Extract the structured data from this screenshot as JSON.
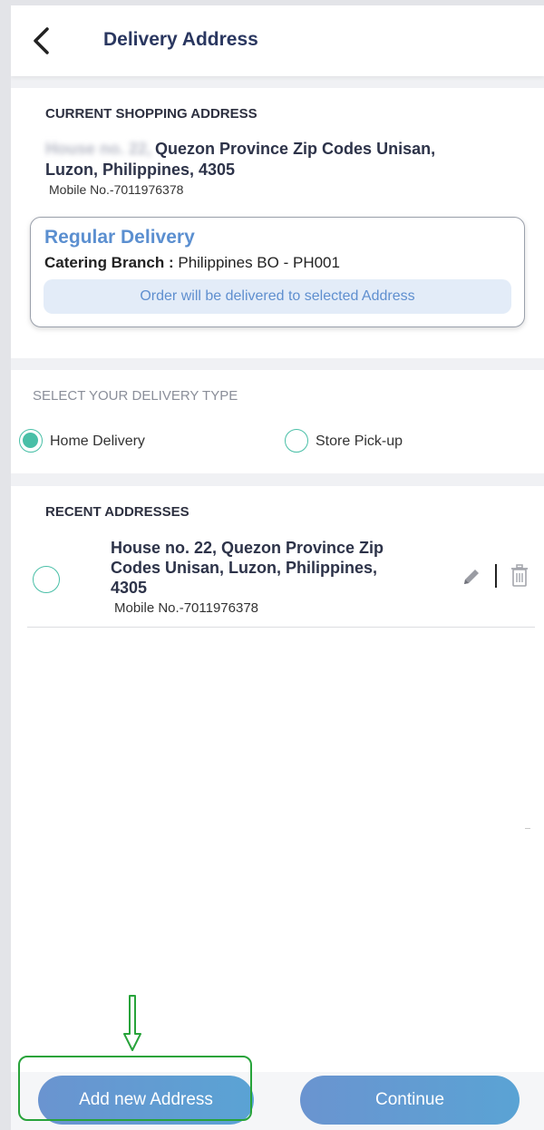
{
  "header": {
    "title": "Delivery Address",
    "back_icon": "chevron-left-icon"
  },
  "current_address": {
    "section_label": "CURRENT SHOPPING ADDRESS",
    "line1_hidden": "House no. 22,",
    "line1_visible": "Quezon Province Zip Codes Unisan,",
    "line2": "Luzon, Philippines, 4305",
    "mobile": "Mobile No.-7011976378"
  },
  "delivery_info": {
    "title": "Regular Delivery",
    "branch_key": "Catering Branch :",
    "branch_value": " Philippines BO - PH001",
    "notice": "Order will be delivered to selected Address"
  },
  "delivery_type": {
    "label": "SELECT YOUR DELIVERY TYPE",
    "options": [
      {
        "label": "Home Delivery",
        "selected": true
      },
      {
        "label": "Store Pick-up",
        "selected": false
      }
    ]
  },
  "recent": {
    "section_label": "RECENT ADDRESSES",
    "items": [
      {
        "address_lines": [
          "House no. 22, Quezon Province Zip",
          "Codes Unisan, Luzon, Philippines,",
          "4305"
        ],
        "mobile": "Mobile No.-7011976378",
        "selected": false,
        "edit_icon": "pencil-icon",
        "delete_icon": "trash-icon"
      }
    ]
  },
  "actions": {
    "add_label": "Add new Address",
    "continue_label": "Continue"
  },
  "colors": {
    "accent_teal": "#49bfa7",
    "brand_blue": "#5b8fd0",
    "title_navy": "#2a3760",
    "highlight_green": "#27a33a"
  }
}
